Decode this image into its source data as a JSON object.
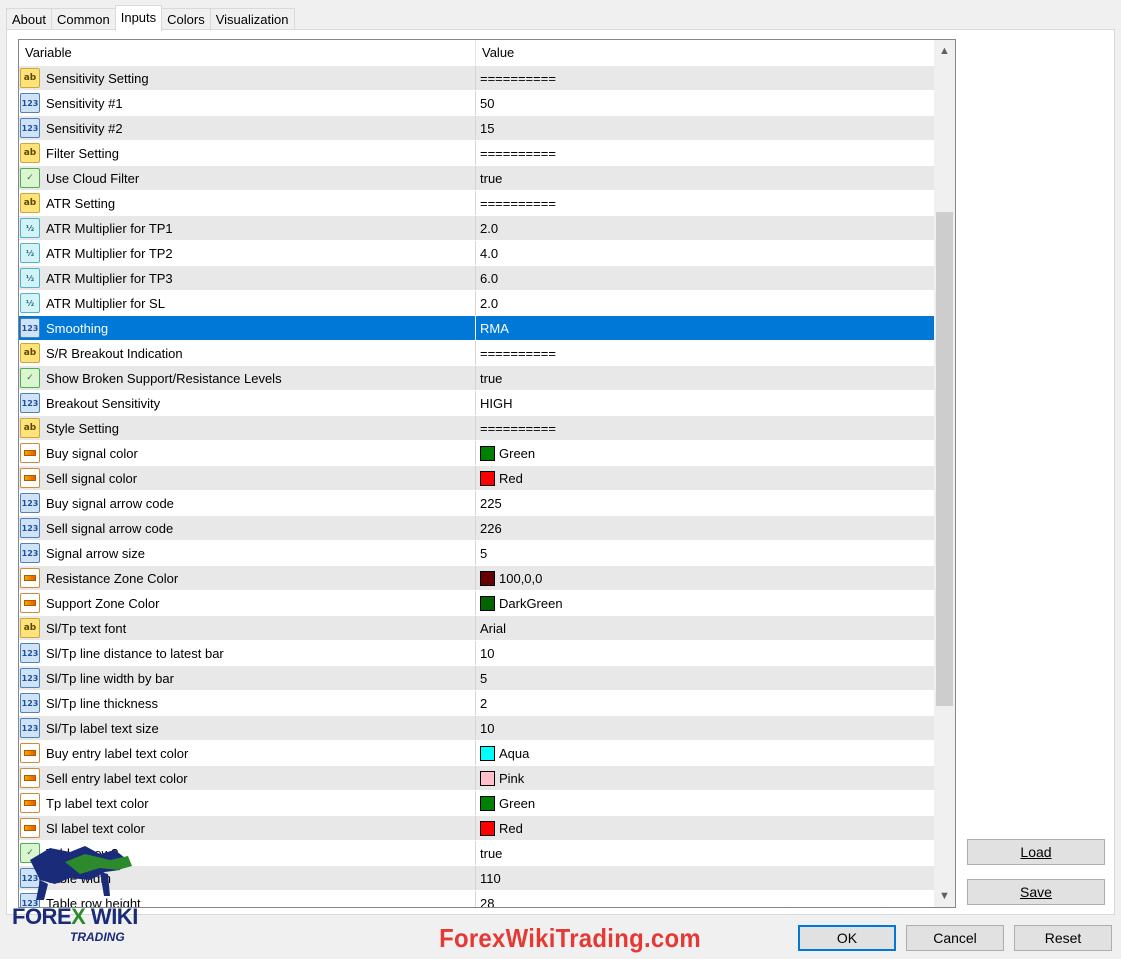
{
  "tabs": [
    {
      "label": "About",
      "active": false
    },
    {
      "label": "Common",
      "active": false
    },
    {
      "label": "Inputs",
      "active": true
    },
    {
      "label": "Colors",
      "active": false
    },
    {
      "label": "Visualization",
      "active": false
    }
  ],
  "grid": {
    "header_variable": "Variable",
    "header_value": "Value",
    "rows": [
      {
        "type": "string",
        "name": "Sensitivity Setting",
        "value": "=========="
      },
      {
        "type": "int",
        "name": "Sensitivity #1",
        "value": "50"
      },
      {
        "type": "int",
        "name": "Sensitivity #2",
        "value": "15"
      },
      {
        "type": "string",
        "name": "Filter Setting",
        "value": "=========="
      },
      {
        "type": "bool",
        "name": "Use Cloud Filter",
        "value": "true"
      },
      {
        "type": "string",
        "name": "ATR Setting",
        "value": "=========="
      },
      {
        "type": "double",
        "name": "ATR Multiplier for TP1",
        "value": "2.0"
      },
      {
        "type": "double",
        "name": "ATR Multiplier for TP2",
        "value": "4.0"
      },
      {
        "type": "double",
        "name": "ATR Multiplier for TP3",
        "value": "6.0"
      },
      {
        "type": "double",
        "name": "ATR Multiplier for SL",
        "value": "2.0"
      },
      {
        "type": "int",
        "name": "Smoothing",
        "value": "RMA",
        "selected": true
      },
      {
        "type": "string",
        "name": "S/R Breakout Indication",
        "value": "=========="
      },
      {
        "type": "bool",
        "name": "Show Broken Support/Resistance Levels",
        "value": "true"
      },
      {
        "type": "int",
        "name": "Breakout Sensitivity",
        "value": "HIGH"
      },
      {
        "type": "string",
        "name": "Style Setting",
        "value": "=========="
      },
      {
        "type": "color",
        "name": "Buy signal color",
        "value": "Green",
        "swatch": "#008000"
      },
      {
        "type": "color",
        "name": "Sell signal color",
        "value": "Red",
        "swatch": "#ff0000"
      },
      {
        "type": "int",
        "name": "Buy signal arrow code",
        "value": "225"
      },
      {
        "type": "int",
        "name": "Sell signal arrow code",
        "value": "226"
      },
      {
        "type": "int",
        "name": "Signal arrow size",
        "value": "5"
      },
      {
        "type": "color",
        "name": "Resistance Zone Color",
        "value": "100,0,0",
        "swatch": "#640000"
      },
      {
        "type": "color",
        "name": "Support Zone Color",
        "value": "DarkGreen",
        "swatch": "#006400"
      },
      {
        "type": "string",
        "name": "Sl/Tp text font",
        "value": "Arial"
      },
      {
        "type": "int",
        "name": "Sl/Tp line distance to latest bar",
        "value": "10"
      },
      {
        "type": "int",
        "name": "Sl/Tp line width by bar",
        "value": "5"
      },
      {
        "type": "int",
        "name": "Sl/Tp line thickness",
        "value": "2"
      },
      {
        "type": "int",
        "name": "Sl/Tp label text size",
        "value": "10"
      },
      {
        "type": "color",
        "name": "Buy entry label text color",
        "value": "Aqua",
        "swatch": "#00ffff"
      },
      {
        "type": "color",
        "name": "Sell entry label text color",
        "value": "Pink",
        "swatch": "#ffc0cb"
      },
      {
        "type": "color",
        "name": "Tp label text color",
        "value": "Green",
        "swatch": "#008000"
      },
      {
        "type": "color",
        "name": "Sl label text color",
        "value": "Red",
        "swatch": "#ff0000"
      },
      {
        "type": "bool",
        "name": "Table show?",
        "value": "true"
      },
      {
        "type": "int",
        "name": "Table width",
        "value": "110"
      },
      {
        "type": "int",
        "name": "Table row height",
        "value": "28"
      }
    ]
  },
  "buttons": {
    "load": "Load",
    "save": "Save",
    "ok": "OK",
    "cancel": "Cancel",
    "reset": "Reset"
  },
  "branding": {
    "logo_text_a": "FORE",
    "logo_text_x": "X",
    "logo_text_b": " WIKI",
    "logo_sub": "TRADING",
    "watermark": "ForexWikiTrading.com"
  },
  "colors": {
    "selection": "#0078d7",
    "row_alt": "#e8e8e8",
    "watermark": "#e53935"
  }
}
